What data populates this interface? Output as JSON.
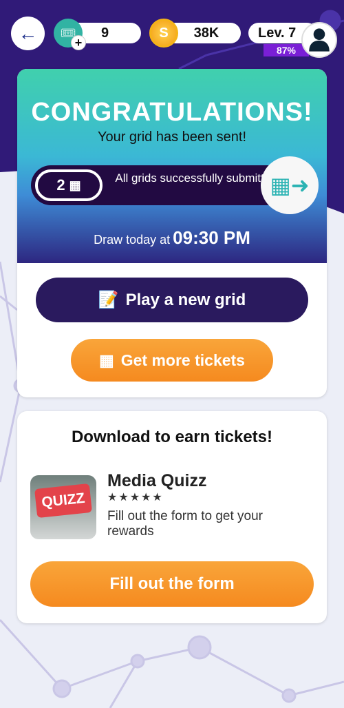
{
  "header": {
    "tickets": "9",
    "coins": "38K",
    "level": "Lev. 7",
    "level_progress": "87%",
    "level_progress_value": 87
  },
  "result_card": {
    "title": "CONGRATULATIONS!",
    "subtitle": "Your grid has been sent!",
    "grid_count": "2",
    "status": "All grids successfully submitted",
    "draw_label": "Draw today at",
    "draw_time": "09:30 PM",
    "play_button": "Play a new grid",
    "tickets_button": "Get more tickets"
  },
  "offer_card": {
    "title": "Download to earn tickets!",
    "app_name": "Media Quizz",
    "app_logo_text": "QUIZZ",
    "rating": 5,
    "stars": "★★★★★",
    "description": "Fill out the form to get your rewards",
    "button": "Fill out the form"
  },
  "colors": {
    "primary_dark": "#2a1a5e",
    "orange": "#f7931e",
    "header_purple": "#301a78",
    "teal": "#31b3a3"
  }
}
